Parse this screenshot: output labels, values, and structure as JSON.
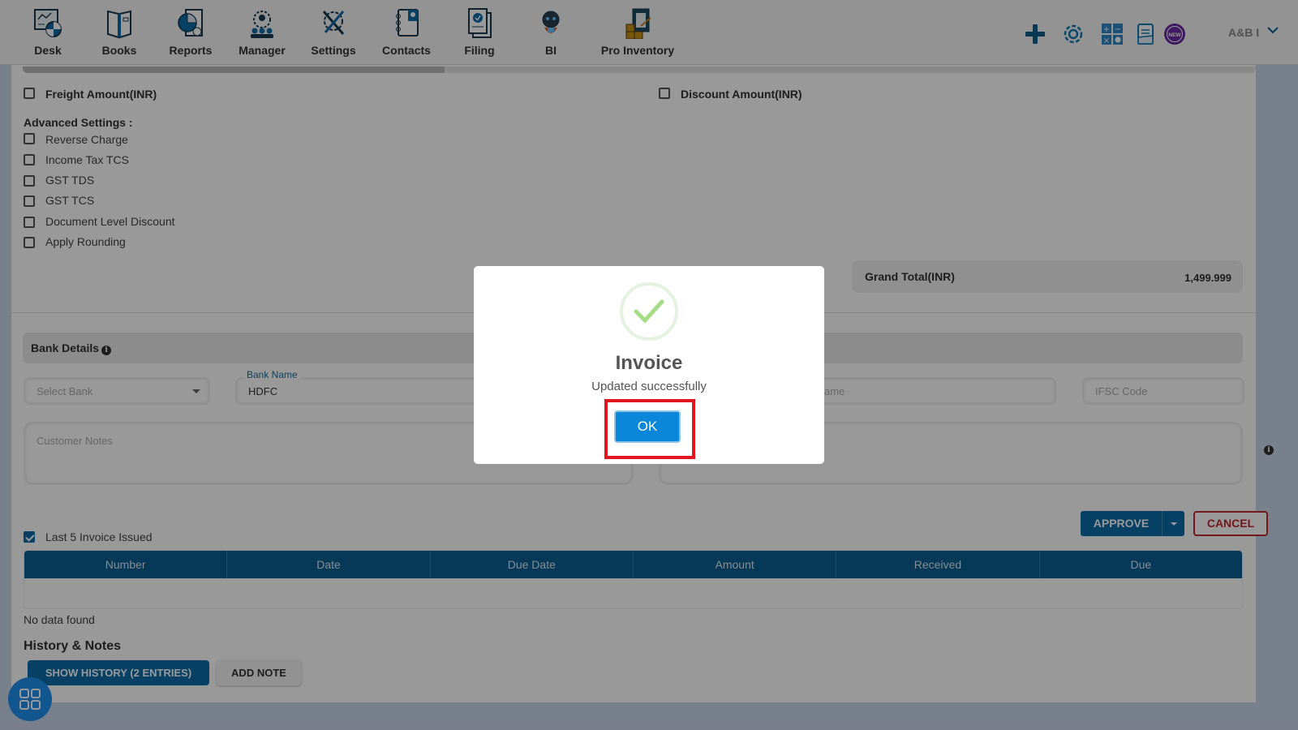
{
  "nav": {
    "items": [
      {
        "label": "Desk",
        "icon": "desk-dashboard-icon"
      },
      {
        "label": "Books",
        "icon": "book-icon"
      },
      {
        "label": "Reports",
        "icon": "pie-report-icon"
      },
      {
        "label": "Manager",
        "icon": "manager-team-icon"
      },
      {
        "label": "Settings",
        "icon": "tools-gear-icon"
      },
      {
        "label": "Contacts",
        "icon": "contacts-book-icon"
      },
      {
        "label": "Filing",
        "icon": "filing-document-icon"
      },
      {
        "label": "BI",
        "icon": "bi-robot-icon"
      },
      {
        "label": "Pro Inventory",
        "icon": "inventory-clipboard-icon"
      }
    ],
    "right_icons": [
      "plus-icon",
      "gear-icon",
      "calculator-icon",
      "notes-icon",
      "new-badge-icon"
    ],
    "new_badge_text": "NEW",
    "user_label": "A&B I"
  },
  "form": {
    "freight_label": "Freight Amount(INR)",
    "discount_label": "Discount Amount(INR)",
    "advanced_title": "Advanced Settings :",
    "advanced_options": [
      {
        "label": "Reverse Charge",
        "checked": false
      },
      {
        "label": "Income Tax TCS",
        "checked": false
      },
      {
        "label": "GST TDS",
        "checked": false
      },
      {
        "label": "GST TCS",
        "checked": false
      },
      {
        "label": "Document Level Discount",
        "checked": false
      },
      {
        "label": "Apply Rounding",
        "checked": false
      }
    ],
    "grand_total_label": "Grand Total(INR)",
    "grand_total_value": "1,499.999"
  },
  "bank": {
    "title": "Bank Details",
    "select_bank_placeholder": "Select Bank",
    "bank_name_label": "Bank Name",
    "bank_name_value": "HDFC",
    "partial_field_placeholder": "ame",
    "ifsc_placeholder": "IFSC Code",
    "customer_notes_placeholder": "Customer Notes"
  },
  "actions": {
    "approve_label": "APPROVE",
    "cancel_label": "CANCEL"
  },
  "last_invoices": {
    "checkbox_label": "Last 5 Invoice Issued",
    "checked": true,
    "columns": [
      "Number",
      "Date",
      "Due Date",
      "Amount",
      "Received",
      "Due"
    ],
    "rows": [],
    "empty_text": "No data found"
  },
  "history": {
    "title": "History & Notes",
    "show_history_label": "SHOW HISTORY (2 ENTRIES)",
    "add_note_label": "ADD NOTE"
  },
  "modal": {
    "title": "Invoice",
    "message": "Updated successfully",
    "ok_label": "OK",
    "success_color": "#a5dc86",
    "highlight_color": "#e0151f"
  }
}
